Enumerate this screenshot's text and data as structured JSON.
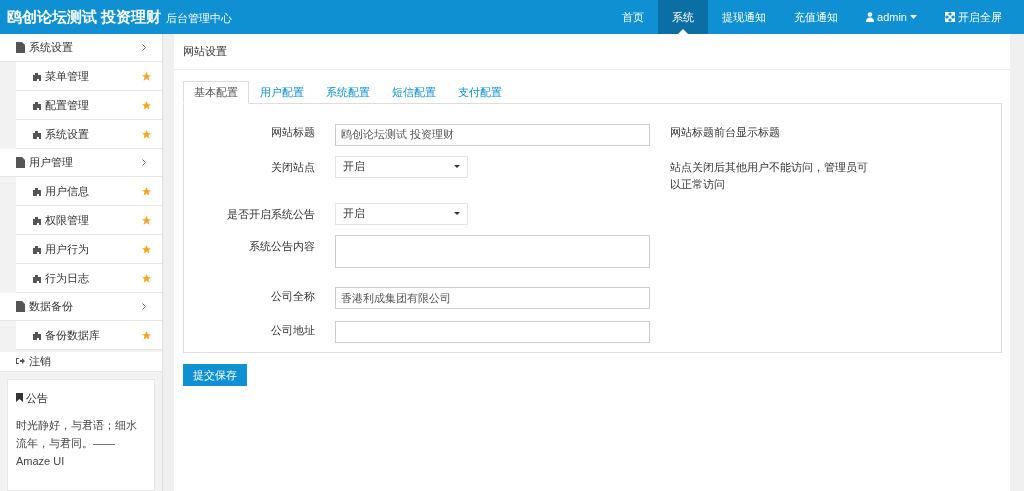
{
  "header": {
    "brand_title": "鸥创论坛测试 投资理财",
    "brand_subtitle": "后台管理中心",
    "nav": [
      {
        "label": "首页",
        "kind": "link",
        "selected": false
      },
      {
        "label": "系统",
        "kind": "link",
        "selected": true
      },
      {
        "label": "提现通知",
        "kind": "link",
        "selected": false
      },
      {
        "label": "充值通知",
        "kind": "link",
        "selected": false
      },
      {
        "label": "admin",
        "kind": "user",
        "selected": false
      },
      {
        "label": "开启全屏",
        "kind": "fullscreen",
        "selected": false
      }
    ]
  },
  "sidebar": {
    "sections": [
      {
        "label": "系统设置",
        "children": [
          {
            "label": "菜单管理"
          },
          {
            "label": "配置管理"
          },
          {
            "label": "系统设置"
          }
        ]
      },
      {
        "label": "用户管理",
        "children": [
          {
            "label": "用户信息"
          },
          {
            "label": "权限管理"
          },
          {
            "label": "用户行为"
          },
          {
            "label": "行为日志"
          }
        ]
      },
      {
        "label": "数据备份",
        "children": [
          {
            "label": "备份数据库"
          }
        ]
      }
    ],
    "logout": "注销",
    "notice": {
      "title": "公告",
      "text": "时光静好，与君语；细水流年，与君同。—— Amaze UI"
    }
  },
  "page": {
    "title": "网站设置",
    "tabs": [
      {
        "label": "基本配置",
        "selected": true
      },
      {
        "label": "用户配置",
        "selected": false
      },
      {
        "label": "系统配置",
        "selected": false
      },
      {
        "label": "短信配置",
        "selected": false
      },
      {
        "label": "支付配置",
        "selected": false
      }
    ],
    "fields": [
      {
        "label": "网站标题",
        "kind": "text",
        "value": "鸥创论坛测试 投资理财",
        "hint": "网站标题前台显示标题"
      },
      {
        "label": "关闭站点",
        "kind": "select",
        "value": "开启",
        "hint": "站点关闭后其他用户不能访问，管理员可以正常访问"
      },
      {
        "label": "是否开启系统公告",
        "kind": "select",
        "value": "开启"
      },
      {
        "label": "系统公告内容",
        "kind": "textarea"
      },
      {
        "label": "公司全称",
        "kind": "text",
        "value": "香港利成集团有限公司"
      },
      {
        "label": "公司地址",
        "kind": "text"
      }
    ],
    "submit": "提交保存"
  }
}
